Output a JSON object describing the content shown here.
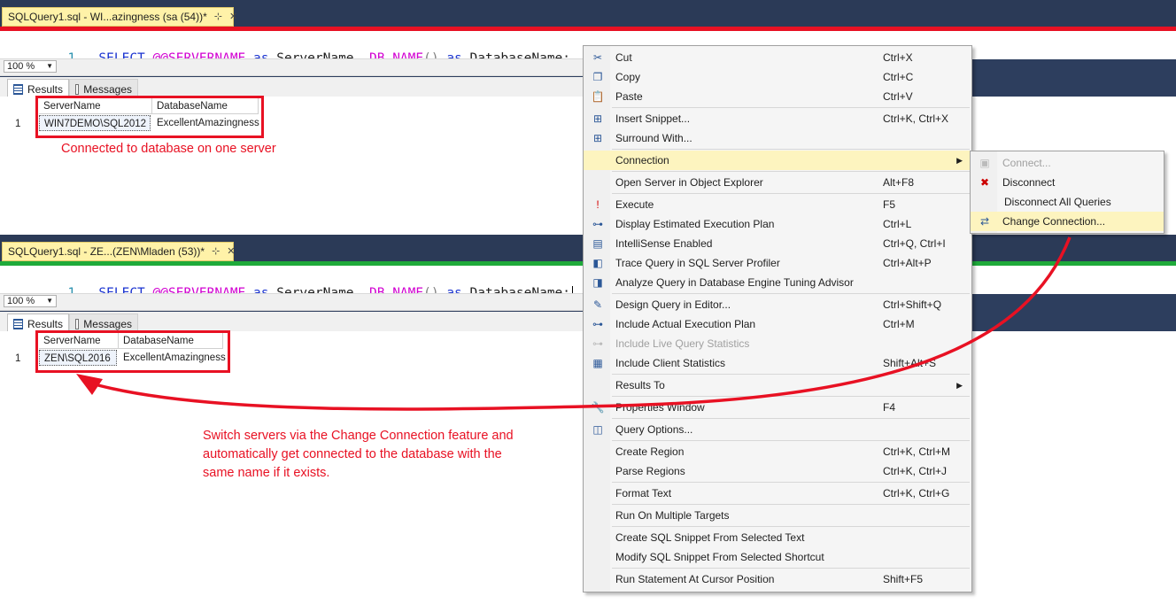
{
  "editor1": {
    "tab_title": "SQLQuery1.sql - WI...azingness (sa (54))*",
    "pin": "⊹",
    "close": "✕",
    "accent_color": "#e81123",
    "line_number": "1",
    "code": {
      "kw1": "SELECT",
      "fn1": "@@SERVERNAME",
      "kw2": "as",
      "id1": "ServerName,",
      "fn2": "DB_NAME",
      "paren": "()",
      "kw3": "as",
      "id2": "DatabaseName;"
    },
    "zoom": "100 %",
    "tabs": {
      "results": "Results",
      "messages": "Messages"
    },
    "grid": {
      "headers": [
        "ServerName",
        "DatabaseName"
      ],
      "row_num": "1",
      "row": [
        "WIN7DEMO\\SQL2012",
        "ExcellentAmazingness"
      ]
    },
    "annotation": "Connected to database on one server"
  },
  "editor2": {
    "tab_title": "SQLQuery1.sql - ZE...(ZEN\\Mladen (53))*",
    "pin": "⊹",
    "close": "✕",
    "accent_color": "#1faa3a",
    "line_number": "1",
    "code": {
      "kw1": "SELECT",
      "fn1": "@@SERVERNAME",
      "kw2": "as",
      "id1": "ServerName,",
      "fn2": "DB_NAME",
      "paren": "()",
      "kw3": "as",
      "id2": "DatabaseName;"
    },
    "zoom": "100 %",
    "tabs": {
      "results": "Results",
      "messages": "Messages"
    },
    "grid": {
      "headers": [
        "ServerName",
        "DatabaseName"
      ],
      "row_num": "1",
      "row": [
        "ZEN\\SQL2016",
        "ExcellentAmazingness"
      ]
    }
  },
  "annotation_main": [
    "Switch servers via the Change Connection feature and",
    "automatically get connected to the database with the",
    "same name if it exists."
  ],
  "context_menu": {
    "items": [
      {
        "label": "Cut",
        "shortcut": "Ctrl+X",
        "icon": "scissors-icon"
      },
      {
        "label": "Copy",
        "shortcut": "Ctrl+C",
        "icon": "copy-icon"
      },
      {
        "label": "Paste",
        "shortcut": "Ctrl+V",
        "icon": "paste-icon"
      },
      {
        "label": "Insert Snippet...",
        "shortcut": "Ctrl+K, Ctrl+X",
        "icon": "insert-snippet-icon"
      },
      {
        "label": "Surround With...",
        "shortcut": "",
        "icon": "surround-with-icon"
      },
      {
        "label": "Connection",
        "shortcut": "",
        "icon": "",
        "submenu": true
      },
      {
        "label": "Open Server in Object Explorer",
        "shortcut": "Alt+F8",
        "icon": ""
      },
      {
        "label": "Execute",
        "shortcut": "F5",
        "icon": "execute-icon"
      },
      {
        "label": "Display Estimated Execution Plan",
        "shortcut": "Ctrl+L",
        "icon": "execution-plan-icon"
      },
      {
        "label": "IntelliSense Enabled",
        "shortcut": "Ctrl+Q, Ctrl+I",
        "icon": "intellisense-icon"
      },
      {
        "label": "Trace Query in SQL Server Profiler",
        "shortcut": "Ctrl+Alt+P",
        "icon": "profiler-icon"
      },
      {
        "label": "Analyze Query in Database Engine Tuning Advisor",
        "shortcut": "",
        "icon": "tuning-advisor-icon"
      },
      {
        "label": "Design Query in Editor...",
        "shortcut": "Ctrl+Shift+Q",
        "icon": "design-query-icon"
      },
      {
        "label": "Include Actual Execution Plan",
        "shortcut": "Ctrl+M",
        "icon": "actual-plan-icon"
      },
      {
        "label": "Include Live Query Statistics",
        "shortcut": "",
        "icon": "live-stats-icon",
        "disabled": true
      },
      {
        "label": "Include Client Statistics",
        "shortcut": "Shift+Alt+S",
        "icon": "client-stats-icon"
      },
      {
        "label": "Results To",
        "shortcut": "",
        "icon": "",
        "submenu": true
      },
      {
        "label": "Properties Window",
        "shortcut": "F4",
        "icon": "wrench-icon"
      },
      {
        "label": "Query Options...",
        "shortcut": "",
        "icon": "query-options-icon"
      },
      {
        "label": "Create Region",
        "shortcut": "Ctrl+K, Ctrl+M",
        "icon": ""
      },
      {
        "label": "Parse Regions",
        "shortcut": "Ctrl+K, Ctrl+J",
        "icon": ""
      },
      {
        "label": "Format Text",
        "shortcut": "Ctrl+K, Ctrl+G",
        "icon": ""
      },
      {
        "label": "Run On Multiple Targets",
        "shortcut": "",
        "icon": ""
      },
      {
        "label": "Create SQL Snippet From Selected Text",
        "shortcut": "",
        "icon": ""
      },
      {
        "label": "Modify SQL Snippet From Selected Shortcut",
        "shortcut": "",
        "icon": ""
      },
      {
        "label": "Run Statement At Cursor Position",
        "shortcut": "Shift+F5",
        "icon": ""
      }
    ]
  },
  "submenu": {
    "items": [
      {
        "label": "Connect...",
        "icon": "connect-icon",
        "disabled": true
      },
      {
        "label": "Disconnect",
        "icon": "disconnect-icon"
      },
      {
        "label": "Disconnect All Queries",
        "icon": ""
      },
      {
        "label": "Change Connection...",
        "icon": "change-connection-icon",
        "highlighted": true
      }
    ]
  }
}
